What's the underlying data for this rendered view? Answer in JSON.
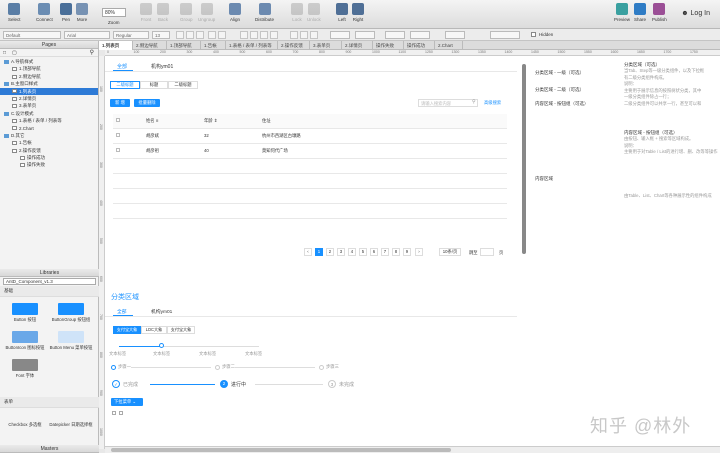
{
  "toolbar": {
    "select": "Select",
    "connect": "Connect",
    "pen": "Pen",
    "more": "More",
    "zoom_value": "80%",
    "zoom_label": "Zoom",
    "front": "Front",
    "back": "Back",
    "group": "Group",
    "ungroup": "Ungroup",
    "align": "Align",
    "distribute": "Distribute",
    "lock": "Lock",
    "unlock": "Unlock",
    "left": "Left",
    "right": "Right",
    "preview": "Preview",
    "share": "Share",
    "publish": "Publish",
    "login": "Log In"
  },
  "format": {
    "style": "Default",
    "font": "Arial",
    "weight": "Regular",
    "size": "13",
    "hidden": "Hidden"
  },
  "pages": {
    "title": "Pages",
    "items": [
      {
        "label": "A.导航样式",
        "type": "folder",
        "indent": 0
      },
      {
        "label": "1.顶部导航",
        "type": "page",
        "indent": 1
      },
      {
        "label": "2.侧边导航",
        "type": "page",
        "indent": 1
      },
      {
        "label": "B.主窗口样式",
        "type": "folder",
        "indent": 0
      },
      {
        "label": "1.列表页",
        "type": "page",
        "indent": 1,
        "selected": true
      },
      {
        "label": "2.详情页",
        "type": "page",
        "indent": 1
      },
      {
        "label": "3.表单页",
        "type": "page",
        "indent": 1
      },
      {
        "label": "C.设计模式",
        "type": "folder",
        "indent": 0
      },
      {
        "label": "1.表格 / 表单 / 列表等",
        "type": "page",
        "indent": 1
      },
      {
        "label": "2.Chart",
        "type": "page",
        "indent": 1
      },
      {
        "label": "D.其它",
        "type": "folder",
        "indent": 0
      },
      {
        "label": "1.告帐",
        "type": "page",
        "indent": 1
      },
      {
        "label": "2.操作反馈",
        "type": "page",
        "indent": 1
      },
      {
        "label": "操作成功",
        "type": "page",
        "indent": 2
      },
      {
        "label": "操作失败",
        "type": "page",
        "indent": 2
      }
    ]
  },
  "libraries": {
    "title": "Libraries",
    "selected": "AntD_Component_v1.3",
    "section1": "基础",
    "section2": "表单",
    "widgets": [
      {
        "label": "Button 按钮",
        "col": 0,
        "row": 0
      },
      {
        "label": "ButtonGroup 按钮组",
        "col": 1,
        "row": 0
      },
      {
        "label": "ButtonIcon 图标按钮",
        "col": 0,
        "row": 1
      },
      {
        "label": "Button Menu 菜单按钮",
        "col": 1,
        "row": 1
      },
      {
        "label": "Font 字体",
        "col": 0,
        "row": 2
      }
    ],
    "form_widgets": [
      "Checkbox 多选框",
      "Datepicker 日期选择框"
    ]
  },
  "masters": {
    "title": "Masters"
  },
  "tabs": [
    {
      "label": "1.列表页",
      "active": true
    },
    {
      "label": "2.侧边导航"
    },
    {
      "label": "1.顶部导航"
    },
    {
      "label": "1.告帐"
    },
    {
      "label": "1.表格 / 表单 / 列表等"
    },
    {
      "label": "2.操作反馈"
    },
    {
      "label": "3.表单页"
    },
    {
      "label": "2.详情页"
    },
    {
      "label": "操作失败"
    },
    {
      "label": "操作成功"
    },
    {
      "label": "2.Chart"
    }
  ],
  "ruler": {
    "h": [
      "0",
      "100",
      "200",
      "300",
      "400",
      "500",
      "600",
      "700",
      "800",
      "900",
      "1000",
      "1100",
      "1250",
      "1300",
      "1350",
      "1400",
      "1450",
      "1500",
      "1550",
      "1600",
      "1650",
      "1700",
      "1750"
    ],
    "v": [
      "100",
      "200",
      "300",
      "400",
      "500",
      "600",
      "700",
      "800",
      "900",
      "1000"
    ]
  },
  "canvas": {
    "top_tabs": [
      "全部",
      "机构ym01"
    ],
    "segments": [
      "二级标题",
      "标题",
      "二级标题"
    ],
    "btn_add": "新 增",
    "btn_batch": "批量删除",
    "search_placeholder": "请输入搜索内容",
    "search_adv": "高级搜索",
    "table": {
      "headers": [
        "",
        "姓名",
        "年龄",
        "住址"
      ],
      "rows": [
        [
          "",
          "胡彦斌",
          "32",
          "杭州市西湖区古墩路"
        ],
        [
          "",
          "胡彦祖",
          "40",
          "莫知何代广场"
        ]
      ]
    },
    "pagination": [
      "1",
      "2",
      "3",
      "4",
      "5",
      "6",
      "7",
      "8",
      "9"
    ],
    "page_size": "10条/页",
    "jump_label": "跳至",
    "jump_suffix": "页",
    "right_labels": [
      "分类区域 - 一级（可选）",
      "分类区域 - 二级（可选）",
      "内容区域 - 按钮组（可选）",
      "内容区域"
    ],
    "right_notes": [
      {
        "title": "分类区域（可选）",
        "lines": [
          "当Tab、Step等一级分类组件，以及下拉框",
          "有二级分类组件构成。",
          "说明：",
          "主要用于展示信息的按照树状分类，其中",
          "一级分类组件除占一行；",
          "二级分类组件可以共享一行，甚至可以和"
        ]
      },
      {
        "title": "内容区域 - 按钮组（可选）",
        "lines": [
          "由按钮、输入框 + 搜索等区域构成。",
          "说明：",
          "主要用于对Table / List的进行增、删、改等等操作"
        ]
      },
      {
        "title": "",
        "lines": [
          "由Table、List、Chart等各种展示性的组件构成"
        ]
      }
    ],
    "section_title": "分类区域",
    "tabs2": [
      "全部",
      "机构ym01"
    ],
    "segs2": [
      "支付宝大象",
      "LDC大象",
      "支付宝大象"
    ],
    "slider_labels": [
      "文本标签",
      "文本标签",
      "文本标签",
      "文本标签"
    ],
    "steps_small": [
      "步骤一",
      "步骤二",
      "步骤三"
    ],
    "steps": [
      {
        "label": "已完成",
        "num": "✓"
      },
      {
        "label": "进行中",
        "num": "2"
      },
      {
        "label": "未完成",
        "num": "3"
      }
    ],
    "dropdown": "下拉菜单",
    "watermark": "知乎 @林外"
  }
}
